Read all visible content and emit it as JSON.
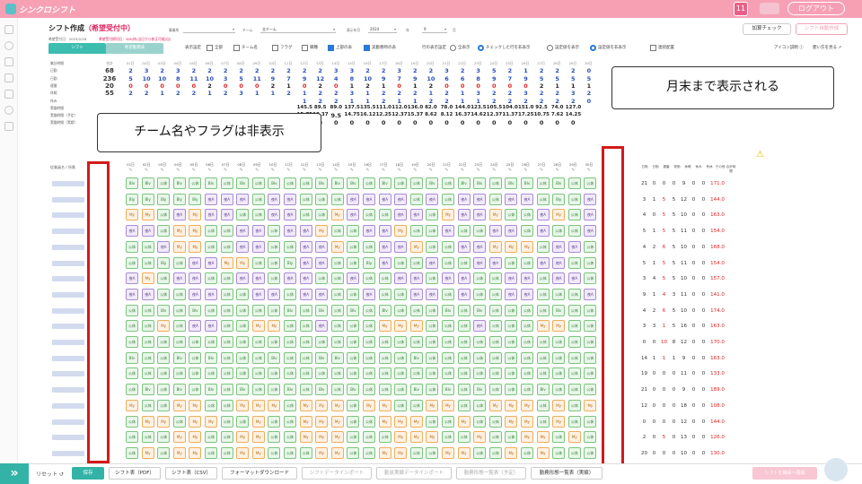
{
  "app": {
    "logo_text": "シンクロシフト",
    "logout_label": "ログアウト",
    "calendar_icon": "calendar-icon",
    "calendar_day": "11"
  },
  "header": {
    "title": "シフト作成",
    "status": "（希望受付中）",
    "sub1": "希望受付日：2023/2/18",
    "sub2": "希望受付締切日：6/6(休)当日から修正可能(出)",
    "store_label": "事業所",
    "store_value": "",
    "team_label": "チーム",
    "team_value": "全チーム",
    "period_label": "表示年月",
    "year_value": "2024",
    "year_unit": "年",
    "month_value": "9",
    "month_unit": "月",
    "add_check_label": "加算チェック",
    "auto_create_label": "シフト自動作成"
  },
  "tabs": {
    "shift": "シフト",
    "request": "希望勤務表"
  },
  "options": {
    "display_label": "表示設定",
    "all_label": "全部",
    "team_label": "チーム名",
    "flag_label": "フラグ",
    "job_label": "職種",
    "top_label": "上部の表",
    "work_label": "実勤務時の表",
    "filter_label": "行の表示設定",
    "show_all": "全表示",
    "checked_only": "チェックした行を非表示",
    "unset_show": "設定値を表示",
    "unset_hide": "設定値を非表示",
    "conflict_label": "連続配置",
    "icon_legend": "アイコン説明 ⓘ",
    "howto": "使い方を見る ↗"
  },
  "summary_rows": [
    {
      "label": "集計時間",
      "values": [
        "合計",
        "01日",
        "02日",
        "03日",
        "04日",
        "05日",
        "06日",
        "07日",
        "08日",
        "09日",
        "10日",
        "11日",
        "12日",
        "13日",
        "14日",
        "15日",
        "16日",
        "17日",
        "18日",
        "19日",
        "20日",
        "21日",
        "22日",
        "23日",
        "24日",
        "25日",
        "26日",
        "27日",
        "28日",
        "29日",
        "30日"
      ]
    },
    {
      "label": "日勤",
      "total": "68",
      "values": [
        "2",
        "3",
        "2",
        "3",
        "2",
        "2",
        "2",
        "2",
        "2",
        "2",
        "2",
        "2",
        "2",
        "3",
        "3",
        "2",
        "2",
        "3",
        "2",
        "2",
        "3",
        "2",
        "3",
        "5",
        "2",
        "1",
        "2",
        "2",
        "2",
        "0"
      ]
    },
    {
      "label": "日勤",
      "total": "236",
      "values": [
        "5",
        "10",
        "10",
        "8",
        "11",
        "10",
        "3",
        "5",
        "11",
        "9",
        "7",
        "9",
        "12",
        "4",
        "8",
        "10",
        "9",
        "7",
        "9",
        "10",
        "6",
        "6",
        "8",
        "9",
        "7",
        "9",
        "5",
        "5",
        "5",
        "5"
      ]
    },
    {
      "label": "遅番",
      "total": "20",
      "values": [
        "0",
        "0",
        "0",
        "0",
        "0",
        "2",
        "0",
        "0",
        "0",
        "2",
        "1",
        "0",
        "2",
        "0",
        "1",
        "2",
        "1",
        "0",
        "1",
        "2",
        "0",
        "0",
        "0",
        "0",
        "0",
        "0",
        "2",
        "1",
        "1",
        "1"
      ]
    },
    {
      "label": "休暇",
      "total": "55",
      "values": [
        "2",
        "2",
        "1",
        "2",
        "2",
        "1",
        "2",
        "3",
        "1",
        "1",
        "2",
        "1",
        "2",
        "2",
        "3",
        "1",
        "2",
        "2",
        "2",
        "1",
        "2",
        "1",
        "3",
        "2",
        "2",
        "3",
        "2",
        "2",
        "3",
        "2"
      ]
    },
    {
      "label": "休み",
      "total": "",
      "values": [
        "",
        "",
        "",
        "",
        "",
        "",
        "",
        "",
        "",
        "",
        "",
        "1",
        "2",
        "2",
        "1",
        "1",
        "2",
        "1",
        "1",
        "2",
        "2",
        "1",
        "1",
        "2",
        "2",
        "2",
        "2",
        "2",
        "2",
        "0"
      ]
    },
    {
      "label": "実働時間",
      "total": "",
      "values": [
        "",
        "",
        "",
        "",
        "",
        "",
        "",
        "",
        "",
        "",
        "",
        "145.5",
        "89.5",
        "89.0",
        "137.5",
        "135.5",
        "111.0",
        "112.0",
        "136.0",
        "82.0",
        "78.0",
        "144.0",
        "123.5",
        "105.5",
        "104.0",
        "151.0",
        "92.5",
        "74.0",
        "127.0"
      ]
    },
    {
      "label": "実働時間（予定）",
      "total": "",
      "values": [
        "",
        "",
        "",
        "",
        "",
        "",
        "",
        "",
        "",
        "",
        "",
        "15.75",
        "10.37",
        "9.5",
        "14.75",
        "16.12",
        "12.25",
        "12.37",
        "15.37",
        "8.62",
        "8.12",
        "16.37",
        "14.62",
        "12.37",
        "11.37",
        "17.25",
        "10.75",
        "7.62",
        "14.25"
      ]
    },
    {
      "label": "実働時間（実績）",
      "total": "",
      "values": [
        "",
        "",
        "",
        "",
        "",
        "",
        "",
        "",
        "",
        "",
        "",
        "0",
        "0",
        "0",
        "0",
        "0",
        "0",
        "0",
        "0",
        "0",
        "0",
        "0",
        "0",
        "0",
        "0",
        "0",
        "0",
        "0",
        "0"
      ]
    }
  ],
  "grid_header": {
    "name_col": "従業員名 / 所属",
    "days": [
      "01日",
      "02日",
      "03日",
      "04日",
      "05日",
      "06日",
      "07日",
      "08日",
      "09日",
      "10日",
      "11日",
      "12日",
      "13日",
      "14日",
      "15日",
      "16日",
      "17日",
      "18日",
      "19日",
      "20日",
      "21日",
      "22日",
      "23日",
      "24日",
      "25日",
      "26日",
      "27日",
      "28日",
      "29日",
      "30日"
    ],
    "right_cols": [
      "日勤",
      "日勤",
      "遅番",
      "夜勤",
      "休暇",
      "休み",
      "有休",
      "その他",
      "合計時間"
    ]
  },
  "employee_summaries": [
    [
      "21",
      "0",
      "0",
      "0",
      "9",
      "0",
      "0",
      "171.0"
    ],
    [
      "3",
      "1",
      "5",
      "5",
      "12",
      "0",
      "0",
      "144.0"
    ],
    [
      "4",
      "0",
      "5",
      "5",
      "10",
      "0",
      "0",
      "163.0"
    ],
    [
      "5",
      "1",
      "5",
      "5",
      "11",
      "0",
      "0",
      "154.0"
    ],
    [
      "4",
      "2",
      "6",
      "5",
      "10",
      "0",
      "0",
      "168.0"
    ],
    [
      "5",
      "1",
      "5",
      "5",
      "11",
      "0",
      "0",
      "154.0"
    ],
    [
      "3",
      "4",
      "5",
      "5",
      "10",
      "0",
      "0",
      "157.0"
    ],
    [
      "9",
      "1",
      "4",
      "3",
      "11",
      "0",
      "0",
      "141.0"
    ],
    [
      "4",
      "2",
      "6",
      "5",
      "10",
      "0",
      "0",
      "174.0"
    ],
    [
      "3",
      "3",
      "1",
      "5",
      "16",
      "0",
      "0",
      "163.0"
    ],
    [
      "0",
      "0",
      "10",
      "8",
      "12",
      "0",
      "0",
      "170.0"
    ],
    [
      "14",
      "1",
      "1",
      "1",
      "9",
      "0",
      "0",
      "163.0"
    ],
    [
      "19",
      "0",
      "0",
      "0",
      "11",
      "0",
      "0",
      "133.0"
    ],
    [
      "21",
      "0",
      "0",
      "0",
      "9",
      "0",
      "0",
      "189.0"
    ],
    [
      "12",
      "0",
      "0",
      "0",
      "18",
      "0",
      "0",
      "108.0"
    ],
    [
      "0",
      "0",
      "0",
      "0",
      "12",
      "0",
      "0",
      "144.0"
    ],
    [
      "2",
      "0",
      "5",
      "0",
      "13",
      "0",
      "0",
      "126.0"
    ],
    [
      "20",
      "0",
      "0",
      "0",
      "10",
      "0",
      "0",
      "130.0"
    ]
  ],
  "shift_rows": [
    [
      "Blv",
      "Blv",
      "公休",
      "Blv",
      "公休",
      "Blv",
      "公休",
      "Blv",
      "公休",
      "Blv",
      "公休",
      "公休",
      "Blv",
      "Blv",
      "Blv",
      "公休",
      "Blv",
      "公休",
      "公休",
      "Blv",
      "公休",
      "Blv",
      "Blv",
      "公休",
      "Blv",
      "Blv",
      "公休",
      "Blv",
      "公休",
      "公休"
    ],
    [
      "Bly",
      "Bly",
      "Bly",
      "Bly",
      "Bly",
      "夜A",
      "夜A",
      "夜A",
      "公休",
      "夜A",
      "夜A",
      "公休",
      "公休",
      "公休",
      "夜A",
      "夜A",
      "夜A",
      "夜A",
      "公休",
      "夜A",
      "公休",
      "夜A",
      "夜A",
      "公休",
      "夜A",
      "夜A",
      "公休",
      "Bly",
      "公休",
      "夜A"
    ],
    [
      "My",
      "My",
      "公休",
      "夜A",
      "My",
      "夜A",
      "夜A",
      "公休",
      "公休",
      "夜A",
      "夜A",
      "公休",
      "公休",
      "My",
      "夜A",
      "公休",
      "公休",
      "夜A",
      "夜A",
      "公休",
      "My",
      "夜A",
      "夜A",
      "My",
      "公休",
      "公休",
      "夜A",
      "My",
      "公休",
      "夜A"
    ],
    [
      "夜A",
      "夜A",
      "公休",
      "My",
      "My",
      "公休",
      "公休",
      "夜A",
      "夜A",
      "公休",
      "夜A",
      "夜A",
      "My",
      "公休",
      "公休",
      "夜A",
      "夜A",
      "My",
      "公休",
      "公休",
      "夜A",
      "公休",
      "公休",
      "夜A",
      "夜A",
      "公休",
      "夜A",
      "公休",
      "公休",
      "夜A"
    ],
    [
      "公休",
      "公休",
      "夜A",
      "My",
      "My",
      "公休",
      "公休",
      "夜A",
      "夜A",
      "公休",
      "公休",
      "夜A",
      "夜A",
      "My",
      "公休",
      "公休",
      "夜A",
      "夜A",
      "My",
      "公休",
      "公休",
      "夜A",
      "夜A",
      "My",
      "My",
      "My",
      "公休",
      "夜A",
      "夜A",
      "公休"
    ],
    [
      "公休",
      "公休",
      "Bly",
      "公休",
      "夜A",
      "夜A",
      "My",
      "My",
      "公休",
      "公休",
      "Bly",
      "夜A",
      "夜A",
      "公休",
      "公休",
      "Bly",
      "夜A",
      "公休",
      "公休",
      "夜A",
      "公休",
      "公休",
      "夜A",
      "夜A",
      "公休",
      "公休",
      "夜A",
      "夜A",
      "公休",
      "公休"
    ],
    [
      "夜A",
      "My",
      "公休",
      "夜A",
      "夜A",
      "公休",
      "公休",
      "夜A",
      "夜A",
      "公休",
      "夜A",
      "夜A",
      "公休",
      "公休",
      "夜A",
      "公休",
      "公休",
      "夜A",
      "夜A",
      "公休",
      "夜A",
      "夜A",
      "公休",
      "公休",
      "夜A",
      "夜A",
      "公休",
      "夜A",
      "夜A",
      "公休"
    ],
    [
      "夜A",
      "夜A",
      "公休",
      "公休",
      "夜A",
      "夜A",
      "公休",
      "公休",
      "夜A",
      "夜A",
      "公休",
      "夜A",
      "夜A",
      "公休",
      "公休",
      "夜A",
      "公休",
      "公休",
      "夜A",
      "夜A",
      "公休",
      "夜A",
      "公休",
      "公休",
      "夜A",
      "夜A",
      "公休",
      "公休",
      "公休",
      "夜A"
    ],
    [
      "公休",
      "公休",
      "Blv",
      "公休",
      "Blv",
      "公休",
      "公休",
      "公休",
      "公休",
      "公休",
      "Blv",
      "公休",
      "Blv",
      "公休",
      "Blv",
      "公休",
      "Blv",
      "公休",
      "公休",
      "公休",
      "Blv",
      "公休",
      "Blv",
      "公休",
      "公休",
      "公休",
      "公休",
      "Blv",
      "公休",
      "公休"
    ],
    [
      "公休",
      "公休",
      "My",
      "公休",
      "夜A",
      "夜A",
      "公休",
      "公休",
      "My",
      "My",
      "公休",
      "公休",
      "夜A",
      "公休",
      "公休",
      "公休",
      "My",
      "My",
      "My",
      "公休",
      "公休",
      "公休",
      "夜A",
      "公休",
      "公休",
      "公休",
      "My",
      "My",
      "公休",
      "公休"
    ],
    [
      "公休",
      "公休",
      "公休",
      "公休",
      "公休",
      "公休",
      "公休",
      "公休",
      "公休",
      "公休",
      "公休",
      "公休",
      "公休",
      "公休",
      "公休",
      "公休",
      "公休",
      "公休",
      "公休",
      "公休",
      "公休",
      "公休",
      "公休",
      "公休",
      "公休",
      "公休",
      "公休",
      "公休",
      "公休",
      "公休"
    ],
    [
      "Blv",
      "公休",
      "公休",
      "Blv",
      "公休",
      "Blv",
      "公休",
      "公休",
      "公休",
      "Blv",
      "公休",
      "公休",
      "Blv",
      "Blv",
      "公休",
      "公休",
      "公休",
      "公休",
      "Blv",
      "公休",
      "公休",
      "公休",
      "公休",
      "公休",
      "公休",
      "公休",
      "公休",
      "公休",
      "公休",
      "公休"
    ],
    [
      "公休",
      "公休",
      "公休",
      "公休",
      "公休",
      "公休",
      "公休",
      "公休",
      "公休",
      "公休",
      "公休",
      "公休",
      "公休",
      "公休",
      "公休",
      "公休",
      "公休",
      "公休",
      "公休",
      "公休",
      "公休",
      "公休",
      "公休",
      "公休",
      "公休",
      "公休",
      "公休",
      "公休",
      "公休",
      "公休"
    ],
    [
      "公休",
      "Blv",
      "公休",
      "Blv",
      "公休",
      "Blv",
      "公休",
      "Blv",
      "公休",
      "公休",
      "Blv",
      "公休",
      "Blv",
      "公休",
      "Blv",
      "公休",
      "公休",
      "公休",
      "Blv",
      "公休",
      "Blv",
      "公休",
      "Blv",
      "公休",
      "公休",
      "公休",
      "Blv",
      "公休",
      "公休",
      "公休"
    ],
    [
      "My",
      "公休",
      "公休",
      "My",
      "My",
      "公休",
      "公休",
      "My",
      "My",
      "My",
      "公休",
      "My",
      "My",
      "My",
      "公休",
      "My",
      "My",
      "公休",
      "公休",
      "My",
      "My",
      "公休",
      "公休",
      "My",
      "My",
      "My",
      "公休",
      "My",
      "公休",
      "My"
    ],
    [
      "公休",
      "My",
      "My",
      "公休",
      "My",
      "My",
      "公休",
      "公休",
      "My",
      "公休",
      "公休",
      "My",
      "My",
      "My",
      "公休",
      "公休",
      "My",
      "My",
      "My",
      "公休",
      "公休",
      "My",
      "公休",
      "公休",
      "My",
      "My",
      "公休",
      "My",
      "公休",
      "公休"
    ],
    [
      "公休",
      "公休",
      "公休",
      "My",
      "My",
      "公休",
      "公休",
      "My",
      "My",
      "公休",
      "公休",
      "My",
      "My",
      "My",
      "公休",
      "公休",
      "公休",
      "My",
      "My",
      "My",
      "公休",
      "公休",
      "My",
      "公休",
      "公休",
      "My",
      "My",
      "公休",
      "My",
      "公休"
    ],
    [
      "公休",
      "My",
      "公休",
      "My",
      "My",
      "公休",
      "公休",
      "My",
      "My",
      "公休",
      "公休",
      "公休",
      "My",
      "My",
      "公休",
      "公休",
      "My",
      "My",
      "公休",
      "公休",
      "My",
      "My",
      "公休",
      "公休",
      "My",
      "公休",
      "My",
      "公休",
      "公休",
      "公休"
    ]
  ],
  "annotations": {
    "left_bubble": "チーム名やフラグは非表示",
    "right_bubble": "月末まで表示される"
  },
  "bottom": {
    "reset_label": "リセット ↺",
    "save_label": "保存",
    "buttons": [
      "シフト表（PDF）",
      "シフト表（CSV）",
      "フォーマットダウンロード",
      "シフトデータインポート",
      "勤怠実績データインポート",
      "勤務形態一覧表（予定）",
      "勤務形態一覧表（実績）"
    ],
    "submit_label": "シフトを職員へ展開"
  },
  "colors": {
    "accent": "#3dbcb0",
    "header": "#f7a0b4",
    "red": "#d21a1a"
  }
}
